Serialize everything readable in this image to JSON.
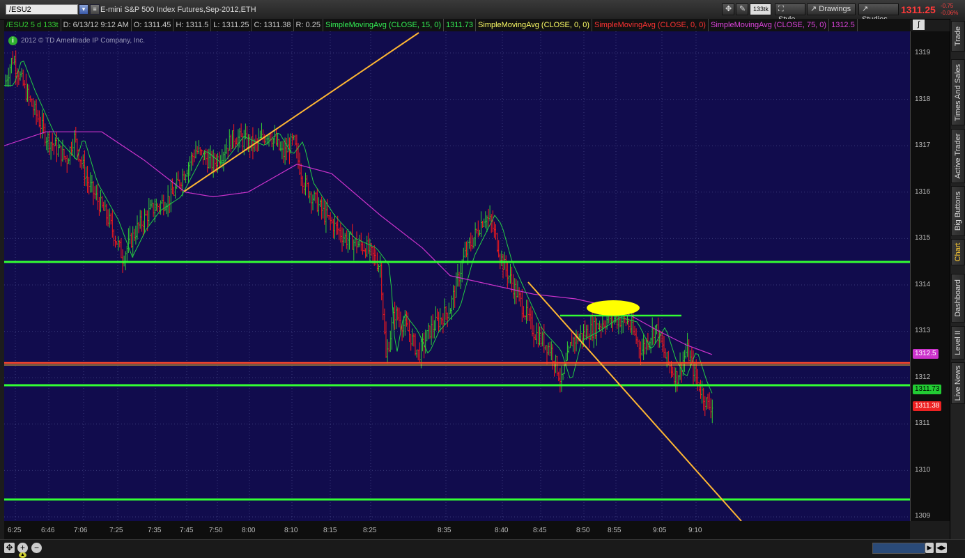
{
  "topbar": {
    "symbol": "/ESU2",
    "description": "E-mini S&P 500 Index Futures,Sep-2012,ETH",
    "aggregation": "133tk",
    "style_label": "Style",
    "drawings_label": "Drawings",
    "studies_label": "Studies",
    "last_price": "1311.25",
    "change": "-0.75",
    "change_pct": "-0.06%"
  },
  "infobar": {
    "symbol_period": "/ESU2 5 d 133t",
    "date": "D: 6/13/12 9:12 AM",
    "open": "O: 1311.45",
    "high": "H: 1311.5",
    "low": "L: 1311.25",
    "close": "C: 1311.38",
    "range": "R: 0.25",
    "sma1_label": "SimpleMovingAvg (CLOSE, 15, 0)",
    "sma1_value": "1311.73",
    "sma2_label": "SimpleMovingAvg (CLOSE, 0, 0)",
    "sma3_label": "SimpleMovingAvg (CLOSE, 0, 0)",
    "sma4_label": "SimpleMovingAvg (CLOSE, 75, 0)",
    "sma4_value": "1312.5"
  },
  "chart": {
    "copyright": "2012 © TD Ameritrade IP Company, Inc.",
    "y_ticks": [
      "1319",
      "1318",
      "1317",
      "1316",
      "1315",
      "1314",
      "1313",
      "1312",
      "1311",
      "1310",
      "1309"
    ],
    "x_ticks": [
      "6:25",
      "6:46",
      "7:06",
      "7:25",
      "7:35",
      "7:45",
      "7:50",
      "8:00",
      "8:10",
      "8:15",
      "8:25",
      "8:35",
      "8:40",
      "8:45",
      "8:50",
      "8:55",
      "9:05",
      "9:10"
    ],
    "price_tags": {
      "sma75": "1312.5",
      "sma15": "1311.73",
      "last": "1311.38"
    },
    "colors": {
      "background": "#110c4d",
      "up_bar": "#33cc33",
      "down_bar": "#ff1a1a",
      "sma15": "#22cc44",
      "sma75": "#cc33cc",
      "support": "#33ff33",
      "trendline": "#ffb733",
      "highlight": "#ffff00"
    }
  },
  "sidetabs": [
    "Trade",
    "Times And Sales",
    "Active Trader",
    "Big Buttons",
    "Chart",
    "Dashboard",
    "Level II",
    "Live News"
  ]
}
